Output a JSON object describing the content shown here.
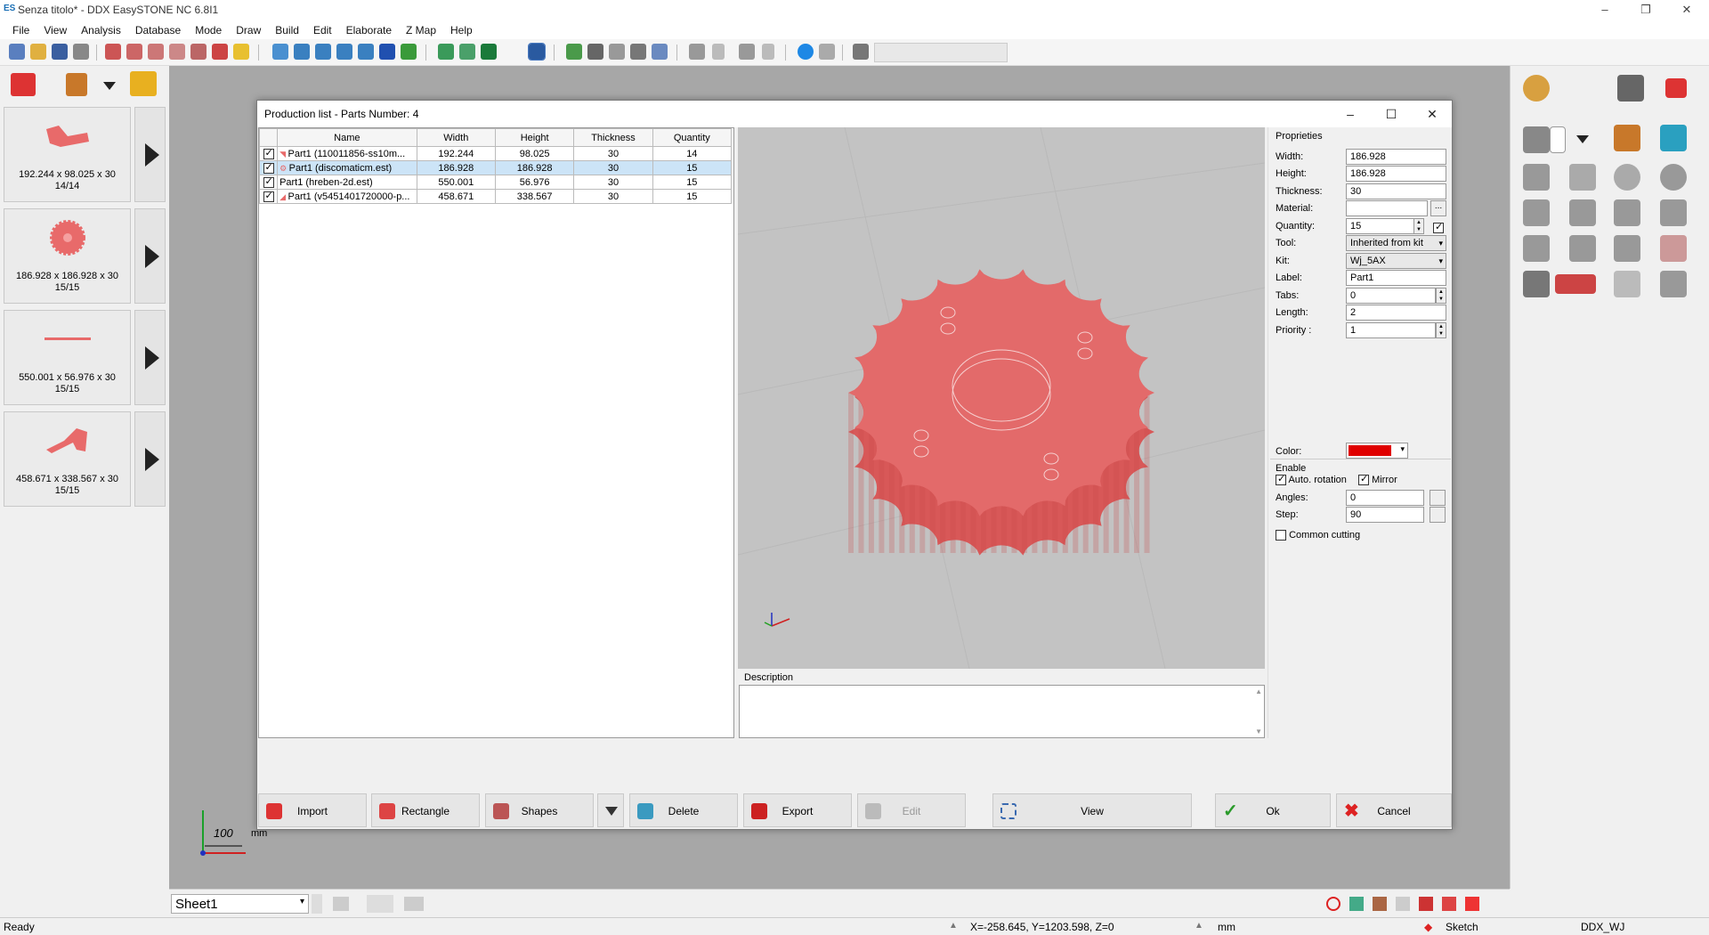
{
  "app": {
    "title": "Senza titolo* - DDX EasySTONE NC 6.8I1",
    "icon": "ES"
  },
  "window_controls": {
    "minimize": "–",
    "restore": "❐",
    "close": "✕"
  },
  "menu": [
    "File",
    "View",
    "Analysis",
    "Database",
    "Mode",
    "Draw",
    "Build",
    "Edit",
    "Elaborate",
    "Z Map",
    "Help"
  ],
  "left_cards": [
    {
      "caption1": "192.244 x 98.025 x 30",
      "caption2": "14/14",
      "shape": "bracket-shape"
    },
    {
      "caption1": "186.928 x 186.928 x 30",
      "caption2": "15/15",
      "shape": "gear-shape"
    },
    {
      "caption1": "550.001 x 56.976 x 30",
      "caption2": "15/15",
      "shape": "strip-shape"
    },
    {
      "caption1": "458.671 x 338.567 x 30",
      "caption2": "15/15",
      "shape": "hook-shape"
    }
  ],
  "scale": {
    "value": "100",
    "unit": "mm"
  },
  "sheet_select": "Sheet1",
  "status": {
    "left": "Ready",
    "coords": "X=-258.645, Y=1203.598, Z=0",
    "unit": "mm",
    "mode": "Sketch",
    "machine": "DDX_WJ"
  },
  "dialog": {
    "title": "Production list - Parts Number: 4",
    "columns": [
      "Name",
      "Width",
      "Height",
      "Thickness",
      "Quantity"
    ],
    "rows": [
      {
        "checked": true,
        "name": "Part1 (110011856-ss10m...",
        "width": "192.244",
        "height": "98.025",
        "thickness": "30",
        "quantity": "14",
        "selected": false
      },
      {
        "checked": true,
        "name": "Part1 (discomaticm.est)",
        "width": "186.928",
        "height": "186.928",
        "thickness": "30",
        "quantity": "15",
        "selected": true
      },
      {
        "checked": true,
        "name": "Part1 (hreben-2d.est)",
        "width": "550.001",
        "height": "56.976",
        "thickness": "30",
        "quantity": "15",
        "selected": false
      },
      {
        "checked": true,
        "name": "Part1 (v5451401720000-p...",
        "width": "458.671",
        "height": "338.567",
        "thickness": "30",
        "quantity": "15",
        "selected": false
      }
    ],
    "description_label": "Description",
    "props": {
      "section": "Proprieties",
      "width_label": "Width:",
      "width": "186.928",
      "height_label": "Height:",
      "height": "186.928",
      "thickness_label": "Thickness:",
      "thickness": "30",
      "material_label": "Material:",
      "material": "",
      "material_btn": "...",
      "quantity_label": "Quantity:",
      "quantity": "15",
      "tool_label": "Tool:",
      "tool": "Inherited from kit",
      "kit_label": "Kit:",
      "kit": "Wj_5AX",
      "label_label": "Label:",
      "label": "Part1",
      "tabs_label": "Tabs:",
      "tabs": "0",
      "length_label": "Length:",
      "length": "2",
      "priority_label": "Priority :",
      "priority": "1",
      "color_label": "Color:",
      "color": "#e00000",
      "enable_label": "Enable",
      "auto_rotation": "Auto. rotation",
      "mirror": "Mirror",
      "angles_label": "Angles:",
      "angles": "0",
      "step_label": "Step:",
      "step": "90",
      "common_cutting": "Common cutting"
    },
    "buttons": {
      "import": "Import",
      "rectangle": "Rectangle",
      "shapes": "Shapes",
      "delete": "Delete",
      "export": "Export",
      "edit": "Edit",
      "view": "View",
      "ok": "Ok",
      "cancel": "Cancel"
    }
  }
}
